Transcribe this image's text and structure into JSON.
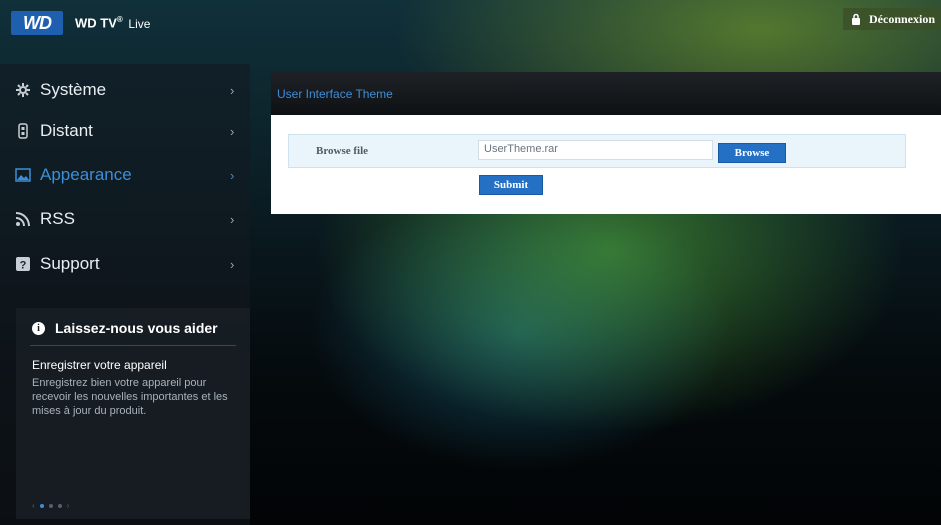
{
  "header": {
    "logo_text": "WD",
    "product_name": "WD TV",
    "product_reg": "®",
    "product_suffix": "Live",
    "logout_label": "Déconnexion"
  },
  "sidebar": {
    "items": [
      {
        "label": "Système",
        "icon": "gear-icon"
      },
      {
        "label": "Distant",
        "icon": "remote-icon"
      },
      {
        "label": "Appearance",
        "icon": "picture-icon",
        "active": true
      },
      {
        "label": "RSS",
        "icon": "rss-icon"
      },
      {
        "label": "Support",
        "icon": "help-icon"
      }
    ],
    "chevron": "›"
  },
  "help": {
    "icon_glyph": "i",
    "title": "Laissez-nous vous aider",
    "subtitle": "Enregistrer votre appareil",
    "text": "Enregistrez bien votre appareil pour recevoir les nouvelles importantes et les mises à jour du produit.",
    "pager_prev": "‹",
    "pager_next": "›"
  },
  "panel": {
    "title": "User Interface Theme",
    "field_label": "Browse file",
    "file_value": "UserTheme.rar",
    "browse_label": "Browse",
    "submit_label": "Submit"
  },
  "colors": {
    "accent": "#3d8ed8",
    "button": "#2470c4",
    "wd_blue": "#1e5fb0"
  }
}
